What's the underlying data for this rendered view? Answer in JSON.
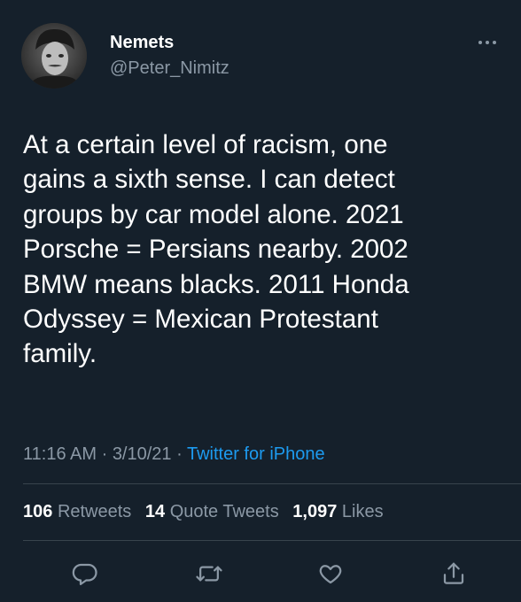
{
  "author": {
    "display_name": "Nemets",
    "handle": "@Peter_Nimitz",
    "avatar_icon": "profile-photo"
  },
  "tweet": {
    "text": "At a certain level of racism, one\ngains a sixth sense. I can detect\ngroups by car model alone. 2021\nPorsche = Persians nearby. 2002\nBMW means blacks. 2011 Honda\nOdyssey = Mexican Protestant\nfamily."
  },
  "meta": {
    "time": "11:16 AM",
    "sep1": " · ",
    "date": "3/10/21",
    "sep2": " · ",
    "source": "Twitter for iPhone"
  },
  "stats": {
    "retweets_count": "106",
    "retweets_label": "Retweets",
    "quotes_count": "14",
    "quotes_label": "Quote Tweets",
    "likes_count": "1,097",
    "likes_label": "Likes"
  },
  "actions": [
    {
      "icon": "reply-icon"
    },
    {
      "icon": "retweet-icon"
    },
    {
      "icon": "like-icon"
    },
    {
      "icon": "share-icon"
    }
  ],
  "colors": {
    "background": "#15202b",
    "primary_text": "#ffffff",
    "secondary_text": "#8b98a5",
    "accent": "#1d9bf0",
    "divider": "#38444d"
  }
}
